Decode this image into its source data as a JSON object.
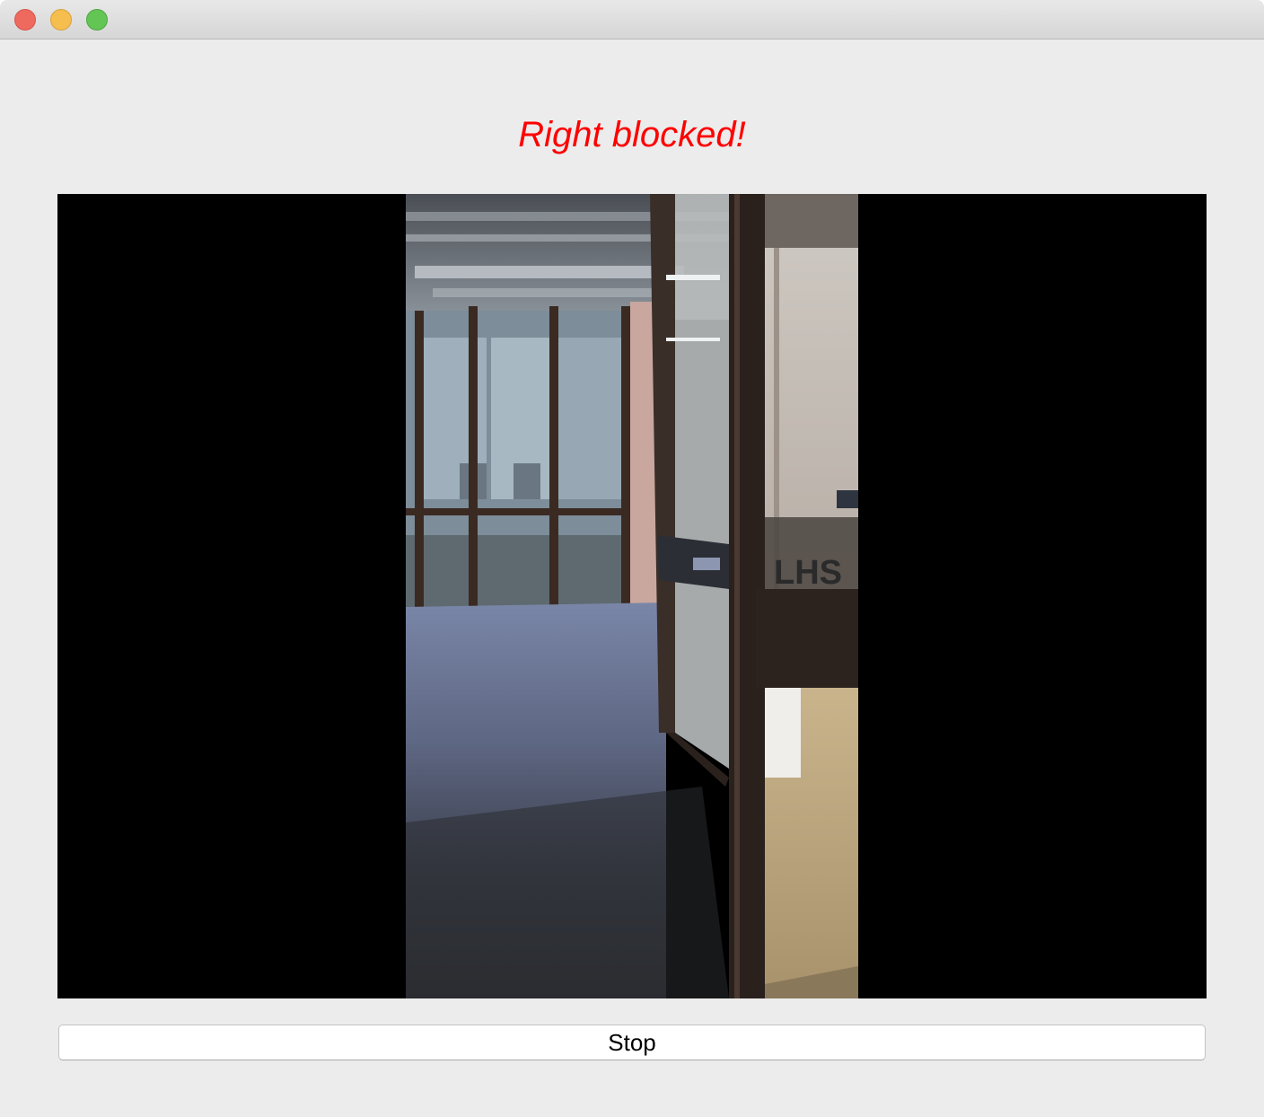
{
  "window": {
    "controls": {
      "close_icon": "close-icon",
      "minimize_icon": "minimize-icon",
      "maximize_icon": "maximize-icon"
    }
  },
  "status": {
    "text": "Right blocked!",
    "color": "#ff0000"
  },
  "video": {
    "background": "#000000",
    "sign_text": "LHS"
  },
  "controls": {
    "stop_label": "Stop"
  }
}
